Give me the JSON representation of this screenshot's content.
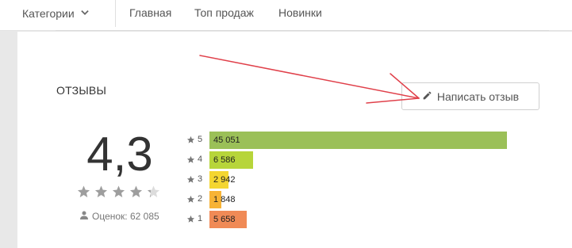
{
  "nav": {
    "categories_label": "Категории",
    "links": [
      "Главная",
      "Топ продаж",
      "Новинки"
    ]
  },
  "reviews": {
    "title": "ОТЗЫВЫ",
    "write_button": "Написать отзыв",
    "score": "4,3",
    "rating_value": 4.3,
    "count_label": "Оценок: 62 085",
    "distribution": [
      {
        "stars": "5",
        "count": "45 051",
        "value": 45051,
        "color": "#9bc058"
      },
      {
        "stars": "4",
        "count": "6 586",
        "value": 6586,
        "color": "#b7d53a"
      },
      {
        "stars": "3",
        "count": "2 942",
        "value": 2942,
        "color": "#f4d631"
      },
      {
        "stars": "2",
        "count": "1 848",
        "value": 1848,
        "color": "#f7b336"
      },
      {
        "stars": "1",
        "count": "5 658",
        "value": 5658,
        "color": "#f08a56"
      }
    ]
  },
  "colors": {
    "annotation_arrow": "#e0404a",
    "star": "#9e9e9e",
    "star_empty": "#dcdcdc"
  },
  "icons": [
    "chevron-down-icon",
    "pencil-icon",
    "star-icon",
    "person-icon"
  ]
}
